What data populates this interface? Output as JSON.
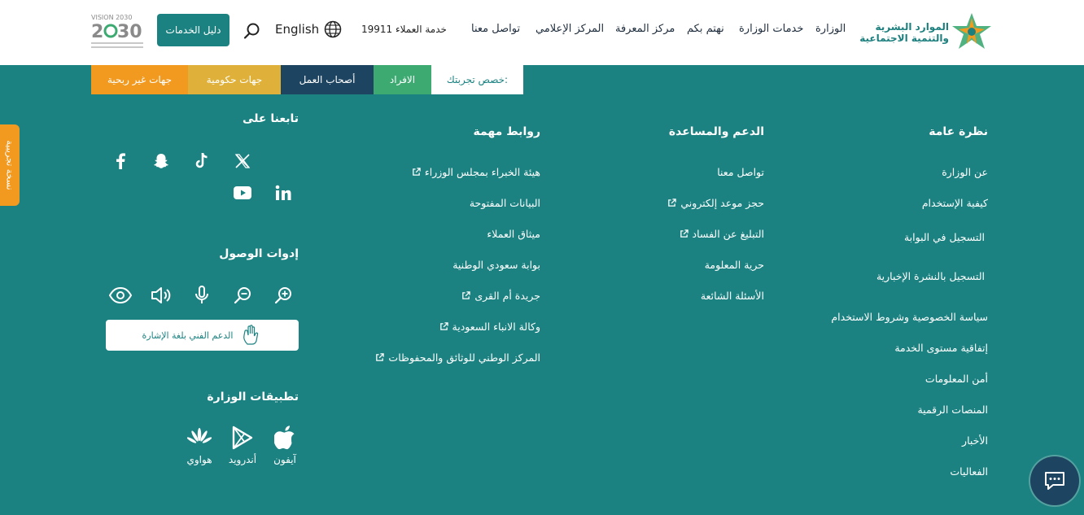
{
  "header": {
    "logo_line1": "الموارد البشرية",
    "logo_line2": "والتنمية الاجتماعية",
    "nav": [
      "الوزارة",
      "خدمات الوزارة",
      "نهتم بكم",
      "مركز المعرفة",
      "المركز الإعلامي",
      "تواصل معنا"
    ],
    "hotline": "خدمة العملاء 19911",
    "language": "English",
    "services_label": "دليل الخدمات",
    "vision_brand": "VISION 2030"
  },
  "segments": {
    "label": "خصص تجربتك:",
    "individuals": "الافراد",
    "employers": "أصحاب العمل",
    "government": "جهات حكومية",
    "nonprofit": "جهات غير ربحية"
  },
  "beta_label": "نسخة تجريبية",
  "overview": {
    "title": "نظرة عامة",
    "links": [
      "عن الوزارة",
      "كيفية الإستخدام",
      "التسجيل في البوابة",
      "التسجيل بالنشرة الإخبارية",
      "سياسة الخصوصية وشروط الاستخدام",
      "إتفاقية مستوى الخدمة",
      "أمن المعلومات",
      "المنصات الرقمية",
      "الأخبار",
      "الفعاليات"
    ]
  },
  "support": {
    "title": "الدعم والمساعدة",
    "links": [
      "تواصل معنا",
      "حجز موعد إلكتروني",
      "التبليغ عن الفساد",
      "حرية المعلومة",
      "الأسئلة الشائعة"
    ]
  },
  "important": {
    "title": "روابط مهمة",
    "links": [
      "هيئة الخبراء بمجلس الوزراء",
      "البيانات المفتوحة",
      "ميثاق العملاء",
      "بوابة سعودي الوطنية",
      "جريدة أم القرى",
      "وكالة الانباء السعودية",
      "المركز الوطني للوثائق والمحفوظات"
    ]
  },
  "follow": {
    "title": "تابعنا على"
  },
  "accessibility": {
    "title": "إدوات الوصول",
    "sign_language": "الدعم الفني بلغة الإشارة"
  },
  "apps": {
    "title": "تطبيقات الوزارة",
    "iphone": "آيفون",
    "android": "أندرويد",
    "huawei": "هواوي"
  },
  "colors": {
    "teal": "#1b8281",
    "navy": "#1d4460",
    "green": "#3daa72",
    "gold": "#e0b13a",
    "orange": "#f2991f"
  }
}
